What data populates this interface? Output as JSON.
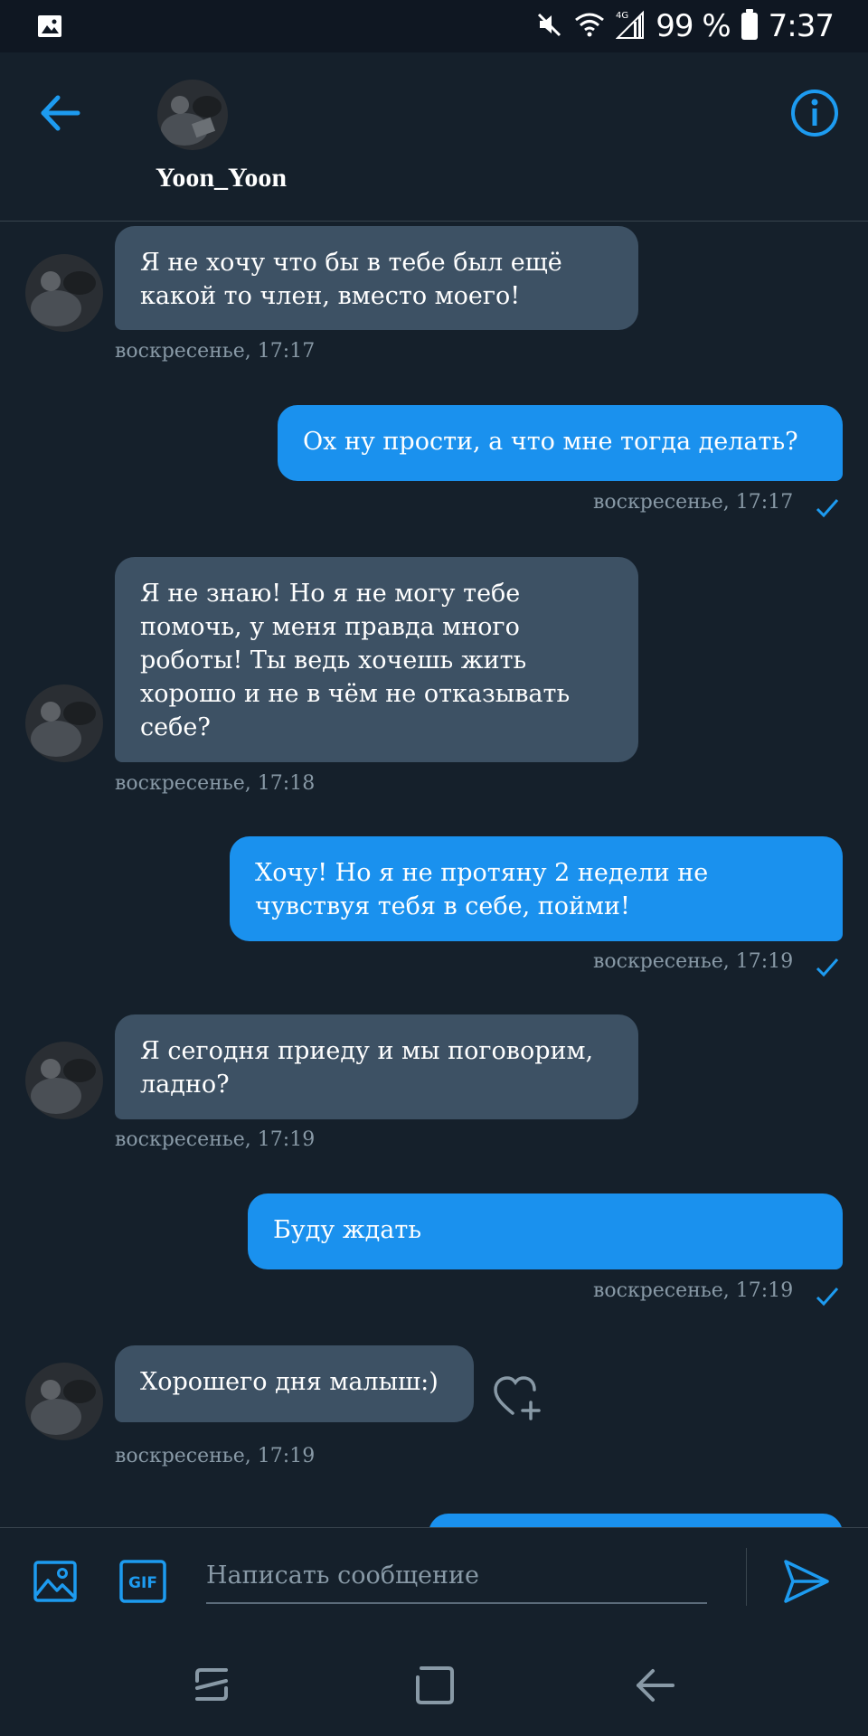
{
  "status_bar": {
    "battery_percent": "99 %",
    "time": "7:37",
    "network": "4G",
    "icons": [
      "image-icon",
      "mute-icon",
      "wifi-icon",
      "signal-icon",
      "battery-icon"
    ]
  },
  "header": {
    "contact_name": "Yoon_Yoon",
    "icons": [
      "back-arrow-icon",
      "info-icon"
    ]
  },
  "messages": [
    {
      "direction": "in",
      "text": "Я не хочу что бы в тебе был ещё какой то член, вместо моего!",
      "timestamp": "воскресенье, 17:17"
    },
    {
      "direction": "out",
      "text": "Ох ну прости, а что мне тогда делать?",
      "timestamp": "воскресенье, 17:17"
    },
    {
      "direction": "in",
      "text": "Я не знаю! Но я не могу тебе помочь, у меня правда много роботы! Ты ведь хочешь жить хорошо и не в чём не отказывать себе?",
      "timestamp": "воскресенье, 17:18"
    },
    {
      "direction": "out",
      "text": "Хочу! Но я не протяну 2 недели не чувствуя тебя в себе, пойми!",
      "timestamp": "воскресенье, 17:19"
    },
    {
      "direction": "in",
      "text": "Я сегодня приеду и мы поговорим, ладно?",
      "timestamp": "воскресенье, 17:19"
    },
    {
      "direction": "out",
      "text": "Буду ждать",
      "timestamp": "воскресенье, 17:19"
    },
    {
      "direction": "in",
      "text": "Хорошего дня малыш:)",
      "timestamp": "воскресенье, 17:19"
    }
  ],
  "composer": {
    "placeholder": "Написать сообщение",
    "gif_label": "GIF"
  },
  "colors": {
    "background": "#15202b",
    "incoming_bubble": "#3d5164",
    "outgoing_bubble": "#1a91ee",
    "accent": "#1d9bf0",
    "timestamp": "#8899a6"
  }
}
